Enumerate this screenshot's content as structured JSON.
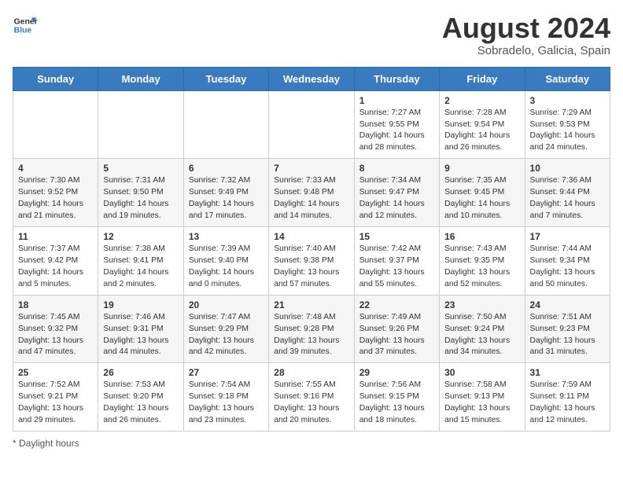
{
  "header": {
    "logo_general": "General",
    "logo_blue": "Blue",
    "month_year": "August 2024",
    "location": "Sobradelo, Galicia, Spain"
  },
  "days_of_week": [
    "Sunday",
    "Monday",
    "Tuesday",
    "Wednesday",
    "Thursday",
    "Friday",
    "Saturday"
  ],
  "weeks": [
    [
      {
        "day": "",
        "info": ""
      },
      {
        "day": "",
        "info": ""
      },
      {
        "day": "",
        "info": ""
      },
      {
        "day": "",
        "info": ""
      },
      {
        "day": "1",
        "info": "Sunrise: 7:27 AM\nSunset: 9:55 PM\nDaylight: 14 hours and 28 minutes."
      },
      {
        "day": "2",
        "info": "Sunrise: 7:28 AM\nSunset: 9:54 PM\nDaylight: 14 hours and 26 minutes."
      },
      {
        "day": "3",
        "info": "Sunrise: 7:29 AM\nSunset: 9:53 PM\nDaylight: 14 hours and 24 minutes."
      }
    ],
    [
      {
        "day": "4",
        "info": "Sunrise: 7:30 AM\nSunset: 9:52 PM\nDaylight: 14 hours and 21 minutes."
      },
      {
        "day": "5",
        "info": "Sunrise: 7:31 AM\nSunset: 9:50 PM\nDaylight: 14 hours and 19 minutes."
      },
      {
        "day": "6",
        "info": "Sunrise: 7:32 AM\nSunset: 9:49 PM\nDaylight: 14 hours and 17 minutes."
      },
      {
        "day": "7",
        "info": "Sunrise: 7:33 AM\nSunset: 9:48 PM\nDaylight: 14 hours and 14 minutes."
      },
      {
        "day": "8",
        "info": "Sunrise: 7:34 AM\nSunset: 9:47 PM\nDaylight: 14 hours and 12 minutes."
      },
      {
        "day": "9",
        "info": "Sunrise: 7:35 AM\nSunset: 9:45 PM\nDaylight: 14 hours and 10 minutes."
      },
      {
        "day": "10",
        "info": "Sunrise: 7:36 AM\nSunset: 9:44 PM\nDaylight: 14 hours and 7 minutes."
      }
    ],
    [
      {
        "day": "11",
        "info": "Sunrise: 7:37 AM\nSunset: 9:42 PM\nDaylight: 14 hours and 5 minutes."
      },
      {
        "day": "12",
        "info": "Sunrise: 7:38 AM\nSunset: 9:41 PM\nDaylight: 14 hours and 2 minutes."
      },
      {
        "day": "13",
        "info": "Sunrise: 7:39 AM\nSunset: 9:40 PM\nDaylight: 14 hours and 0 minutes."
      },
      {
        "day": "14",
        "info": "Sunrise: 7:40 AM\nSunset: 9:38 PM\nDaylight: 13 hours and 57 minutes."
      },
      {
        "day": "15",
        "info": "Sunrise: 7:42 AM\nSunset: 9:37 PM\nDaylight: 13 hours and 55 minutes."
      },
      {
        "day": "16",
        "info": "Sunrise: 7:43 AM\nSunset: 9:35 PM\nDaylight: 13 hours and 52 minutes."
      },
      {
        "day": "17",
        "info": "Sunrise: 7:44 AM\nSunset: 9:34 PM\nDaylight: 13 hours and 50 minutes."
      }
    ],
    [
      {
        "day": "18",
        "info": "Sunrise: 7:45 AM\nSunset: 9:32 PM\nDaylight: 13 hours and 47 minutes."
      },
      {
        "day": "19",
        "info": "Sunrise: 7:46 AM\nSunset: 9:31 PM\nDaylight: 13 hours and 44 minutes."
      },
      {
        "day": "20",
        "info": "Sunrise: 7:47 AM\nSunset: 9:29 PM\nDaylight: 13 hours and 42 minutes."
      },
      {
        "day": "21",
        "info": "Sunrise: 7:48 AM\nSunset: 9:28 PM\nDaylight: 13 hours and 39 minutes."
      },
      {
        "day": "22",
        "info": "Sunrise: 7:49 AM\nSunset: 9:26 PM\nDaylight: 13 hours and 37 minutes."
      },
      {
        "day": "23",
        "info": "Sunrise: 7:50 AM\nSunset: 9:24 PM\nDaylight: 13 hours and 34 minutes."
      },
      {
        "day": "24",
        "info": "Sunrise: 7:51 AM\nSunset: 9:23 PM\nDaylight: 13 hours and 31 minutes."
      }
    ],
    [
      {
        "day": "25",
        "info": "Sunrise: 7:52 AM\nSunset: 9:21 PM\nDaylight: 13 hours and 29 minutes."
      },
      {
        "day": "26",
        "info": "Sunrise: 7:53 AM\nSunset: 9:20 PM\nDaylight: 13 hours and 26 minutes."
      },
      {
        "day": "27",
        "info": "Sunrise: 7:54 AM\nSunset: 9:18 PM\nDaylight: 13 hours and 23 minutes."
      },
      {
        "day": "28",
        "info": "Sunrise: 7:55 AM\nSunset: 9:16 PM\nDaylight: 13 hours and 20 minutes."
      },
      {
        "day": "29",
        "info": "Sunrise: 7:56 AM\nSunset: 9:15 PM\nDaylight: 13 hours and 18 minutes."
      },
      {
        "day": "30",
        "info": "Sunrise: 7:58 AM\nSunset: 9:13 PM\nDaylight: 13 hours and 15 minutes."
      },
      {
        "day": "31",
        "info": "Sunrise: 7:59 AM\nSunset: 9:11 PM\nDaylight: 13 hours and 12 minutes."
      }
    ]
  ],
  "footer": {
    "note": "* Daylight hours"
  }
}
